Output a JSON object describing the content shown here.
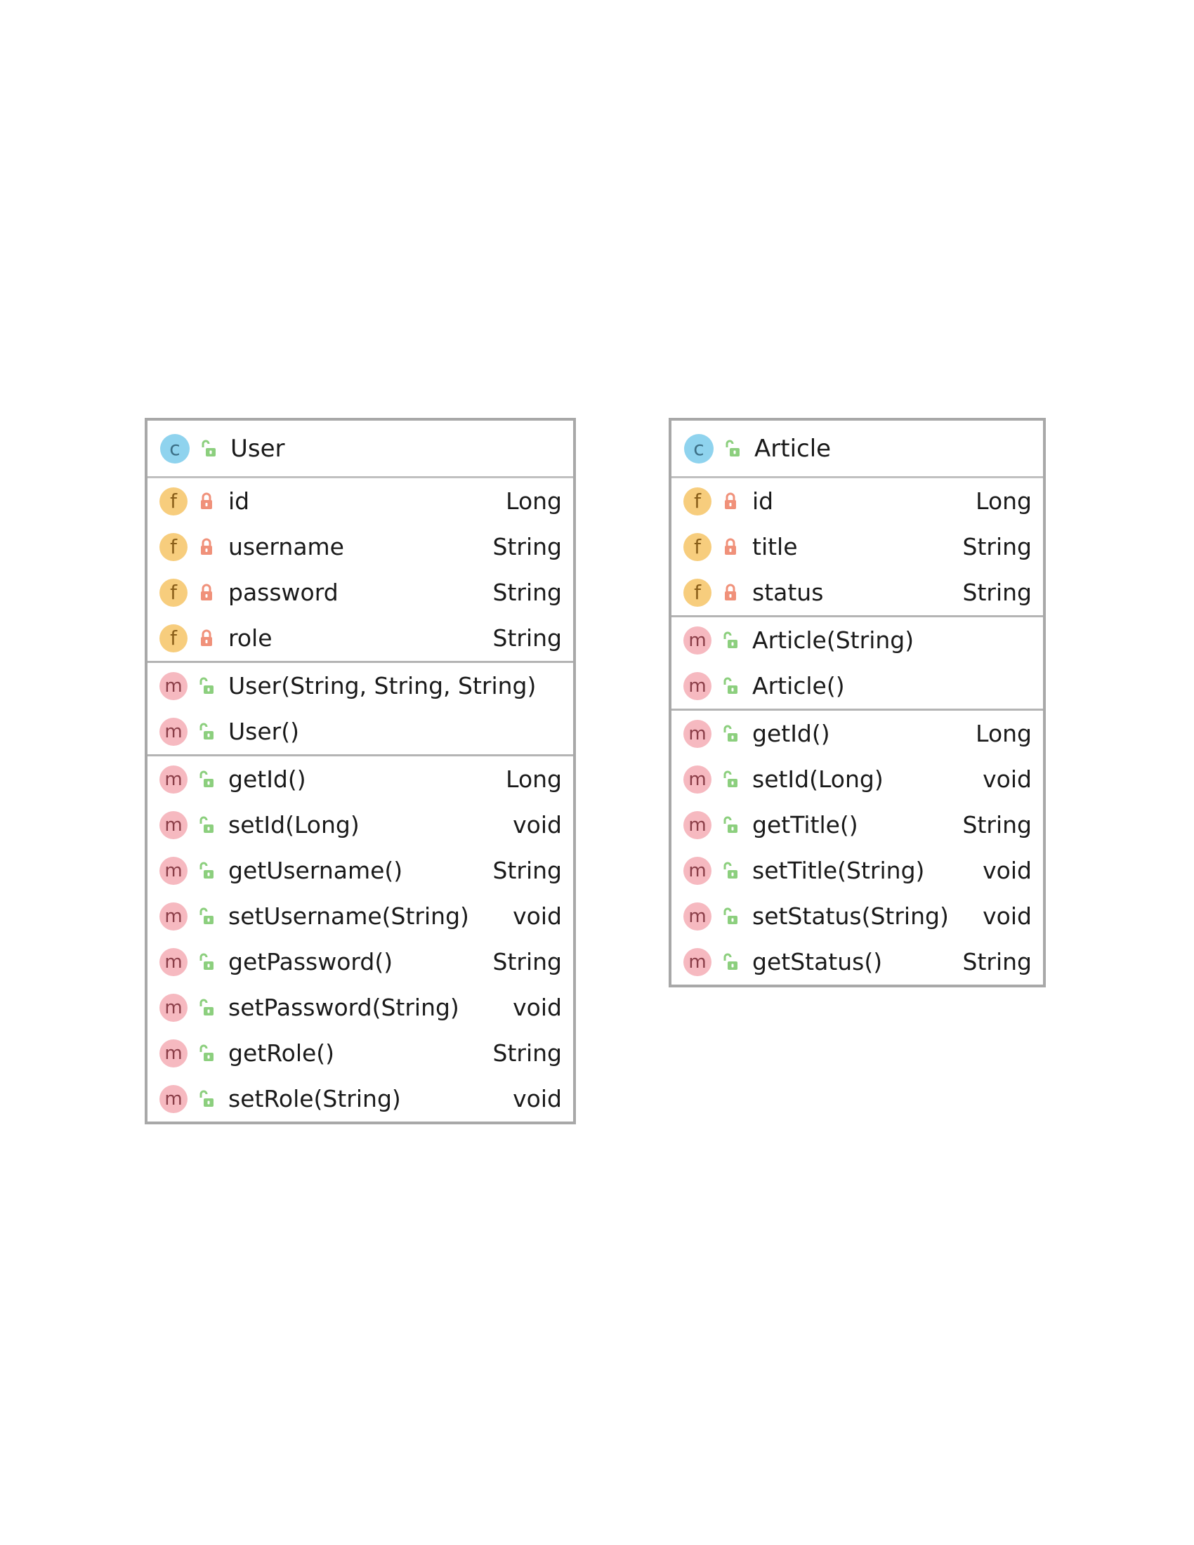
{
  "classes": [
    {
      "name": "User",
      "kind_icon": "class-icon",
      "kind_letter": "c",
      "visibility": "public",
      "fields": [
        {
          "name": "id",
          "type": "Long",
          "visibility": "private"
        },
        {
          "name": "username",
          "type": "String",
          "visibility": "private"
        },
        {
          "name": "password",
          "type": "String",
          "visibility": "private"
        },
        {
          "name": "role",
          "type": "String",
          "visibility": "private"
        }
      ],
      "constructors": [
        {
          "name": "User(String, String, String)",
          "type": "",
          "visibility": "public"
        },
        {
          "name": "User()",
          "type": "",
          "visibility": "public"
        }
      ],
      "methods": [
        {
          "name": "getId()",
          "type": "Long",
          "visibility": "public"
        },
        {
          "name": "setId(Long)",
          "type": "void",
          "visibility": "public"
        },
        {
          "name": "getUsername()",
          "type": "String",
          "visibility": "public"
        },
        {
          "name": "setUsername(String)",
          "type": "void",
          "visibility": "public"
        },
        {
          "name": "getPassword()",
          "type": "String",
          "visibility": "public"
        },
        {
          "name": "setPassword(String)",
          "type": "void",
          "visibility": "public"
        },
        {
          "name": "getRole()",
          "type": "String",
          "visibility": "public"
        },
        {
          "name": "setRole(String)",
          "type": "void",
          "visibility": "public"
        }
      ]
    },
    {
      "name": "Article",
      "kind_icon": "class-icon",
      "kind_letter": "c",
      "visibility": "public",
      "fields": [
        {
          "name": "id",
          "type": "Long",
          "visibility": "private"
        },
        {
          "name": "title",
          "type": "String",
          "visibility": "private"
        },
        {
          "name": "status",
          "type": "String",
          "visibility": "private"
        }
      ],
      "constructors": [
        {
          "name": "Article(String)",
          "type": "",
          "visibility": "public"
        },
        {
          "name": "Article()",
          "type": "",
          "visibility": "public"
        }
      ],
      "methods": [
        {
          "name": "getId()",
          "type": "Long",
          "visibility": "public"
        },
        {
          "name": "setId(Long)",
          "type": "void",
          "visibility": "public"
        },
        {
          "name": "getTitle()",
          "type": "String",
          "visibility": "public"
        },
        {
          "name": "setTitle(String)",
          "type": "void",
          "visibility": "public"
        },
        {
          "name": "setStatus(String)",
          "type": "void",
          "visibility": "public"
        },
        {
          "name": "getStatus()",
          "type": "String",
          "visibility": "public"
        }
      ]
    }
  ],
  "legend": {
    "field_letter": "f",
    "method_letter": "m",
    "colors": {
      "class_badge": "#8fd3ee",
      "field_badge": "#f7cd7d",
      "method_badge": "#f6b9c0",
      "private_lock": "#f0917a",
      "public_lock": "#8ccf7e",
      "border": "#a8a8a8"
    }
  }
}
